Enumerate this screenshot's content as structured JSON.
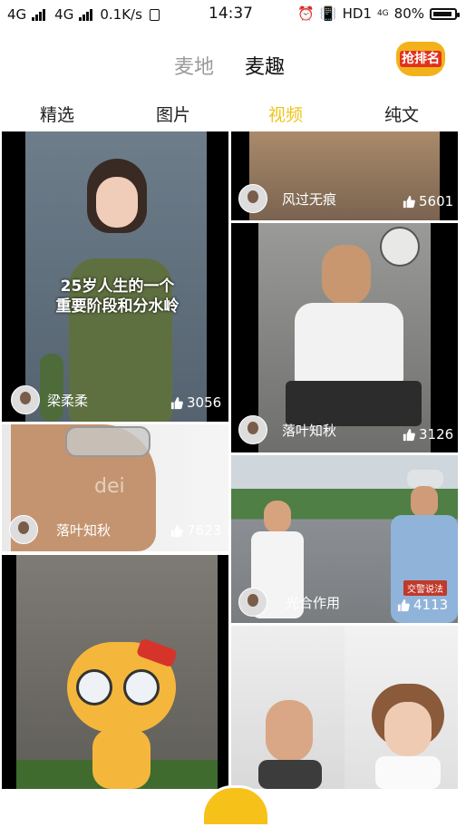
{
  "status_bar": {
    "network1": "4G",
    "network2": "4G",
    "speed": "0.1K/s",
    "time": "14:37",
    "hd": "HD1",
    "net_small": "4G",
    "battery": "80%"
  },
  "top_tabs": [
    "麦地",
    "麦趣"
  ],
  "rank_badge": "抢排名",
  "sub_tabs": [
    "精选",
    "图片",
    "视频",
    "纯文"
  ],
  "cards": [
    {
      "user": "梁柔柔",
      "likes": "3056",
      "overlay_line1": "25岁人生的一个",
      "overlay_line2": "重要阶段和分水岭"
    },
    {
      "user": "风过无痕",
      "likes": "5601"
    },
    {
      "user": "落叶知秋",
      "likes": "3126"
    },
    {
      "user": "落叶知秋",
      "likes": "7623",
      "watermark": "dei"
    },
    {
      "user": "光合作用",
      "likes": "4113",
      "badge": "交警说法"
    },
    {},
    {}
  ],
  "colors": {
    "accent": "#f0c419",
    "badge_red": "#e0321e"
  }
}
